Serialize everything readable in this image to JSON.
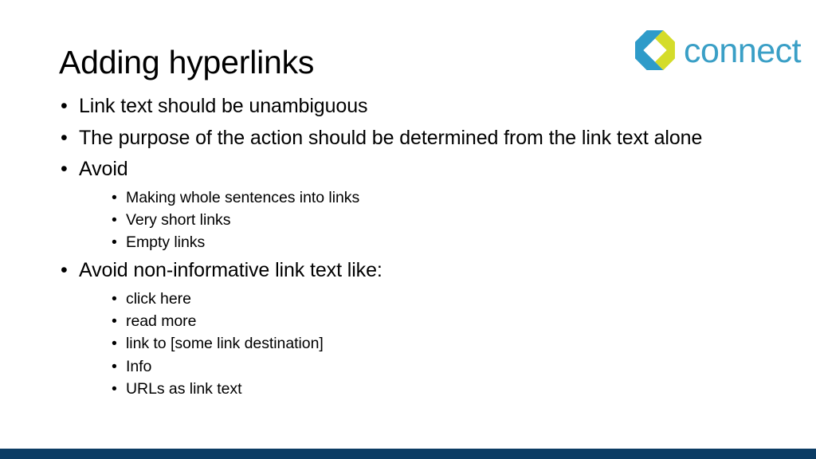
{
  "slide": {
    "title": "Adding hyperlinks",
    "background_color": "#FFFFFF",
    "bottom_bar_color": "#0B3C64"
  },
  "logo": {
    "wordmark": "connect",
    "mark_icon": "connect-hexagon-logo-icon",
    "wordmark_color": "#3A9FC6",
    "mark_teal_color": "#2E9BC9",
    "mark_lime_color": "#D4DC2A"
  },
  "content": {
    "bullet_glyph": "•",
    "items": [
      {
        "text": "Link text should be unambiguous",
        "sub": []
      },
      {
        "text": "The purpose of the action should be determined from the link text alone",
        "sub": []
      },
      {
        "text": "Avoid",
        "sub": [
          "Making whole sentences into links",
          "Very short links",
          "Empty links"
        ]
      },
      {
        "text": "Avoid non-informative link text like:",
        "sub": [
          "click here",
          "read more",
          "link to [some link destination]",
          "Info",
          "URLs as link text"
        ]
      }
    ]
  }
}
